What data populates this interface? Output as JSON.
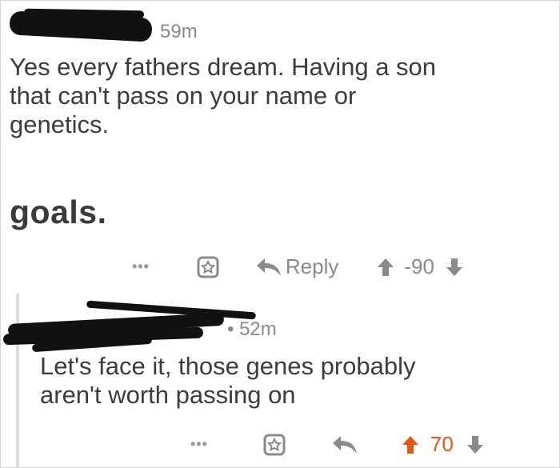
{
  "comment1": {
    "time": "59m",
    "lines": [
      "Yes every fathers dream. Having a son",
      "that can't pass on your name or",
      "genetics."
    ],
    "bold_line": "goals.",
    "actions": {
      "more": "•••",
      "reply_label": "Reply",
      "score": "-90"
    }
  },
  "comment2": {
    "time": "52m",
    "lines": [
      "Let's face it, those genes probably",
      "aren't worth passing on"
    ],
    "actions": {
      "more": "•••",
      "score": "70"
    }
  },
  "colors": {
    "upvote_active": "#e25a12",
    "icon_gray": "#8a8a8a"
  },
  "icons": [
    "gift-icon",
    "reply-icon",
    "upvote-icon",
    "downvote-icon",
    "more-icon"
  ]
}
